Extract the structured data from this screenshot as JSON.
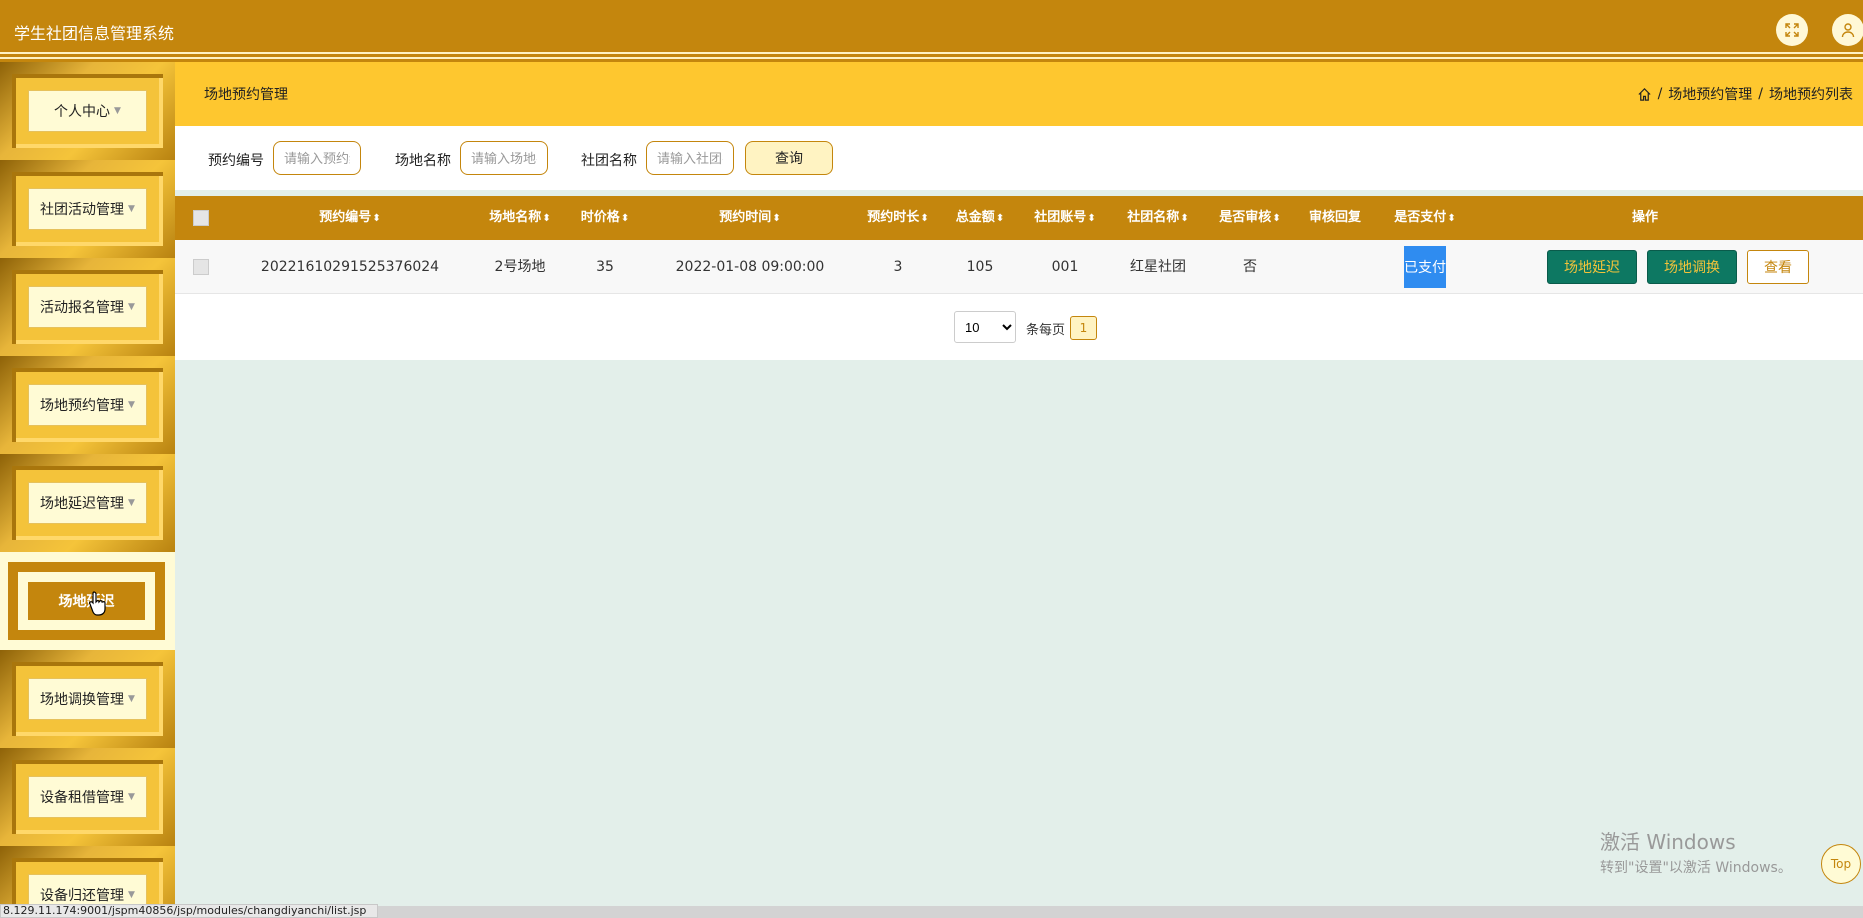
{
  "app": {
    "title": "学生社团信息管理系统"
  },
  "header": {
    "fullscreen_icon": "fullscreen-icon",
    "user_icon": "user-icon"
  },
  "sidebar": {
    "items": [
      {
        "label": "个人中心",
        "active": false
      },
      {
        "label": "社团活动管理",
        "active": false
      },
      {
        "label": "活动报名管理",
        "active": false
      },
      {
        "label": "场地预约管理",
        "active": false
      },
      {
        "label": "场地延迟管理",
        "active": false
      },
      {
        "label": "场地延迟",
        "active": true
      },
      {
        "label": "场地调换管理",
        "active": false
      },
      {
        "label": "设备租借管理",
        "active": false
      },
      {
        "label": "设备归还管理",
        "active": false
      }
    ]
  },
  "page": {
    "title": "场地预约管理",
    "breadcrumb": {
      "sep": "/",
      "level1": "场地预约管理",
      "level2": "场地预约列表"
    }
  },
  "search": {
    "field1_label": "预约编号",
    "field1_placeholder": "请输入预约编号",
    "field2_label": "场地名称",
    "field2_placeholder": "请输入场地名称",
    "field3_label": "社团名称",
    "field3_placeholder": "请输入社团名称",
    "button_label": "查询"
  },
  "table": {
    "headers": [
      "预约编号",
      "场地名称",
      "时价格",
      "预约时间",
      "预约时长",
      "总金额",
      "社团账号",
      "社团名称",
      "是否审核",
      "审核回复",
      "是否支付",
      "操作"
    ],
    "sort_glyph": "⬍",
    "rows": [
      {
        "booking_no": "20221610291525376024",
        "venue": "2号场地",
        "hourly_price": "35",
        "booking_time": "2022-01-08 09:00:00",
        "duration": "3",
        "total": "105",
        "club_account": "001",
        "club_name": "红星社团",
        "reviewed": "否",
        "review_reply": "",
        "paid": "已支付",
        "actions": [
          "场地延迟",
          "场地调换",
          "查看"
        ]
      }
    ]
  },
  "pager": {
    "page_size": "10",
    "per_page_label": "条每页",
    "current_page": "1"
  },
  "watermark": {
    "line1": "激活 Windows",
    "line2": "转到\"设置\"以激活 Windows。"
  },
  "top_button": "Top",
  "statusbar": {
    "url": "8.129.11.174:9001/jspm40856/jsp/modules/changdiyanchi/list.jsp"
  },
  "colors": {
    "brand": "#c4860d",
    "accent": "#fec72f",
    "paid": "#2f8cf0",
    "action": "#0d7862"
  }
}
